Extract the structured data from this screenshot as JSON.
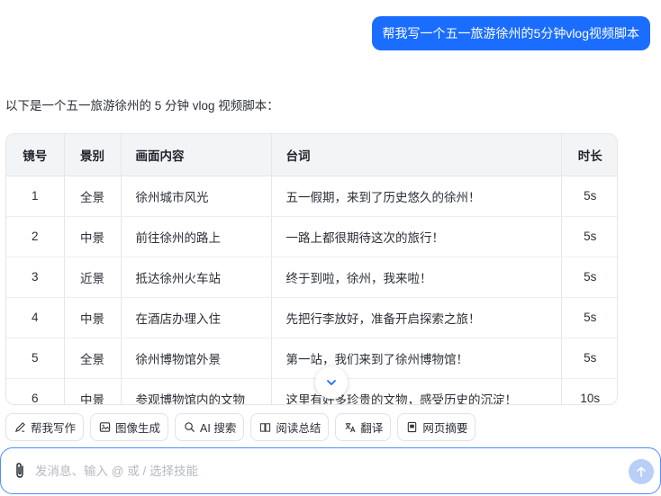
{
  "user_message": "帮我写一个五一旅游徐州的5分钟vlog视频脚本",
  "assistant": {
    "intro": "以下是一个五一旅游徐州的 5 分钟 vlog 视频脚本：",
    "table": {
      "headers": [
        "镜号",
        "景别",
        "画面内容",
        "台词",
        "时长"
      ],
      "rows": [
        [
          "1",
          "全景",
          "徐州城市风光",
          "五一假期，来到了历史悠久的徐州！",
          "5s"
        ],
        [
          "2",
          "中景",
          "前往徐州的路上",
          "一路上都很期待这次的旅行！",
          "5s"
        ],
        [
          "3",
          "近景",
          "抵达徐州火车站",
          "终于到啦，徐州，我来啦！",
          "5s"
        ],
        [
          "4",
          "中景",
          "在酒店办理入住",
          "先把行李放好，准备开启探索之旅！",
          "5s"
        ],
        [
          "5",
          "全景",
          "徐州博物馆外景",
          "第一站，我们来到了徐州博物馆！",
          "5s"
        ],
        [
          "6",
          "中景",
          "参观博物馆内的文物",
          "这里有好多珍贵的文物，感受历史的沉淀！",
          "10s"
        ]
      ]
    }
  },
  "skills": [
    {
      "label": "帮我写作",
      "icon": "pen-icon"
    },
    {
      "label": "图像生成",
      "icon": "image-icon"
    },
    {
      "label": "AI 搜索",
      "icon": "ai-search-icon"
    },
    {
      "label": "阅读总结",
      "icon": "read-icon"
    },
    {
      "label": "翻译",
      "icon": "translate-icon"
    },
    {
      "label": "网页摘要",
      "icon": "webpage-icon"
    }
  ],
  "composer": {
    "placeholder": "发消息、输入 @ 或 / 选择技能"
  },
  "colors": {
    "accent": "#1a6dff",
    "send_disabled": "#b8cff7"
  }
}
